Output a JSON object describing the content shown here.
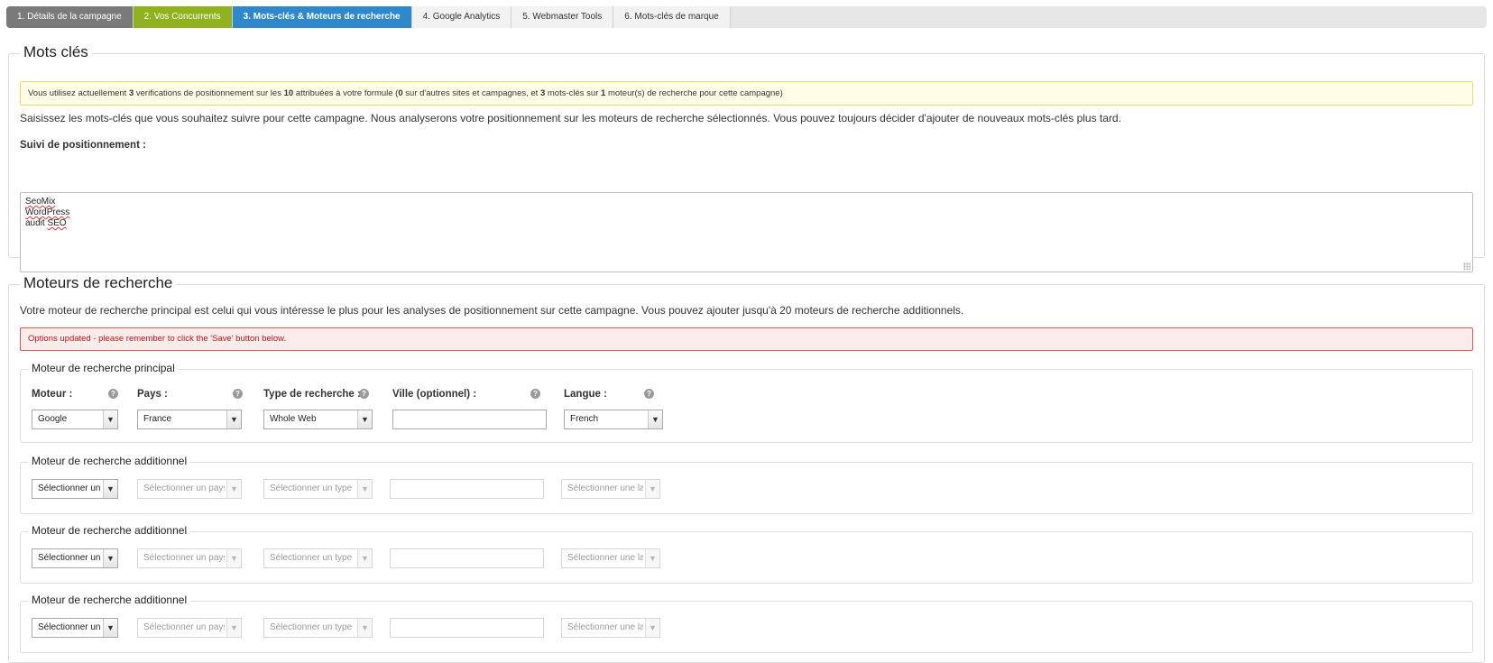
{
  "tabs": [
    {
      "label": "1. Détails de la campagne"
    },
    {
      "label": "2. Vos Concurrents"
    },
    {
      "label": "3. Mots-clés & Moteurs de recherche"
    },
    {
      "label": "4. Google Analytics"
    },
    {
      "label": "5. Webmaster Tools"
    },
    {
      "label": "6. Mots-clés de marque"
    }
  ],
  "keywords": {
    "legend": "Mots clés",
    "notice": {
      "p1": "Vous utilisez actuellement ",
      "used": "3",
      "p2": " verifications de positionnement sur les ",
      "total": "10",
      "p3": " attribuées à votre formule (",
      "other": "0",
      "p4": " sur d'autres sites et campagnes, et ",
      "kw_count": "3",
      "p5": " mots-clés sur ",
      "engines": "1",
      "p6": " moteur(s) de recherche pour cette campagne)"
    },
    "description": "Saisissez les mots-clés que vous souhaitez suivre pour cette campagne. Nous analyserons votre positionnement sur les moteurs de recherche sélectionnés. Vous pouvez toujours décider d'ajouter de nouveaux mots-clés plus tard.",
    "tracking_label": "Suivi de positionnement :",
    "lines": [
      "SeoMix",
      "WordPress",
      "audit ",
      "SEO"
    ]
  },
  "engines": {
    "legend": "Moteurs de recherche",
    "description": "Votre moteur de recherche principal est celui qui vous intéresse le plus pour les analyses de positionnement sur cette campagne. Vous pouvez ajouter jusqu'à 20 moteurs de recherche additionnels.",
    "notice": "Options updated - please remember to click the 'Save' button below.",
    "primary": {
      "legend": "Moteur de recherche principal",
      "labels": {
        "engine": "Moteur :",
        "country": "Pays :",
        "type": "Type de recherche :",
        "city": "Ville (optionnel) :",
        "language": "Langue :"
      },
      "values": {
        "engine": "Google",
        "country": "France",
        "type": "Whole Web",
        "city": "",
        "language": "French"
      },
      "help_glyph": "?"
    },
    "additional": [
      {
        "legend": "Moteur de recherche additionnel",
        "engine": "Sélectionner un moteur",
        "country": "Sélectionner un pays",
        "type": "Sélectionner un type",
        "language": "Sélectionner une langue"
      },
      {
        "legend": "Moteur de recherche additionnel",
        "engine": "Sélectionner un moteur",
        "country": "Sélectionner un pays",
        "type": "Sélectionner un type",
        "language": "Sélectionner une langue"
      },
      {
        "legend": "Moteur de recherche additionnel",
        "engine": "Sélectionner un moteur",
        "country": "Sélectionner un pays",
        "type": "Sélectionner un type",
        "language": "Sélectionner une langue"
      }
    ]
  },
  "icons": {
    "caret": "chevron-down-icon",
    "help": "question-circle-icon",
    "resize": "resize-grip-icon"
  },
  "colors": {
    "tab_done": "#7a7a7a",
    "tab_competitors": "#8fb21e",
    "tab_active": "#2e88c9",
    "notice_yellow_bg": "#fffde8",
    "notice_red_text": "#c0141b"
  }
}
